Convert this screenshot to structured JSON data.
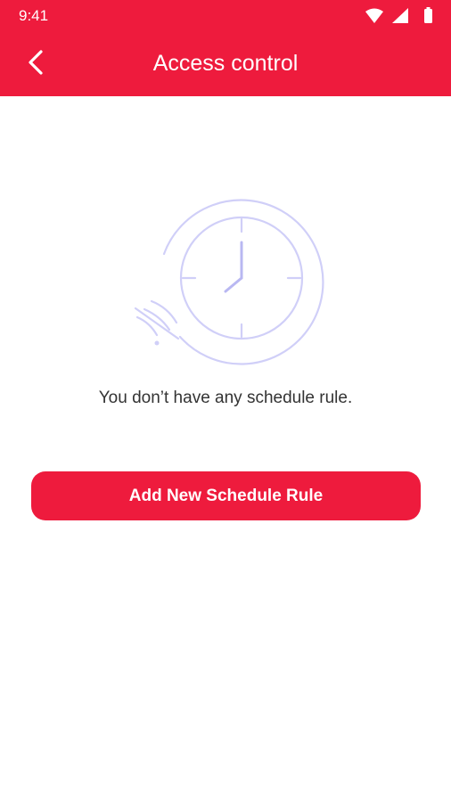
{
  "colors": {
    "primary": "#ee1b3d",
    "illustration": "#d0cff8",
    "text": "#333333",
    "background": "#ffffff"
  },
  "status_bar": {
    "time": "9:41",
    "icons": [
      "wifi-icon",
      "signal-icon",
      "battery-icon"
    ]
  },
  "header": {
    "back_icon": "chevron-left-icon",
    "title": "Access control"
  },
  "empty_state": {
    "illustration_icon": "clock-icon",
    "message": "You don’t have any schedule rule."
  },
  "actions": {
    "add_label": "Add New Schedule Rule"
  }
}
